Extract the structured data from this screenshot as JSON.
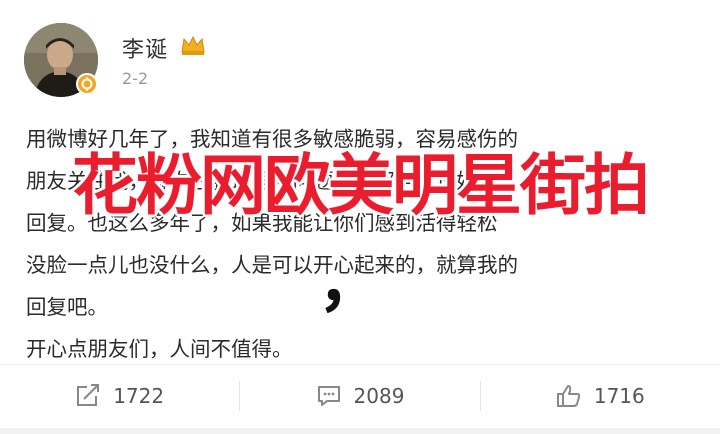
{
  "post": {
    "author": "李诞",
    "date": "2-2",
    "body_lines": [
      "用微博好几年了，我知道有很多敏感脆弱，容易感伤的",
      "朋友关注我，每次在我这里发问题，我都努力说好话",
      "回复。也这么多年了，如果我能让你们感到活得轻松",
      "没脸一点儿也没什么，人是可以开心起来的，就算我的",
      "回复吧。",
      "开心点朋友们，人间不值得。"
    ]
  },
  "watermark": {
    "text": "花粉网欧美明星街拍",
    "comma": "，"
  },
  "actions": {
    "repost_count": "1722",
    "comment_count": "2089",
    "like_count": "1716"
  },
  "icons": {
    "avatar": "avatar-photo",
    "badge": "verified-badge-icon",
    "crown": "vip-crown-icon",
    "repost": "repost-icon",
    "comment": "comment-icon",
    "like": "thumbs-up-icon"
  },
  "colors": {
    "watermark": "#ea1d2f",
    "badge": "#f5a623",
    "crown": "#f2b01e"
  }
}
